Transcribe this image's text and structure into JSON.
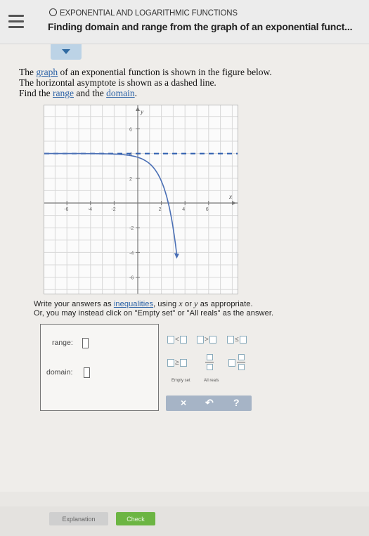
{
  "header": {
    "menu_icon": "hamburger-icon",
    "subtitle": "EXPONENTIAL AND LOGARITHMIC FUNCTIONS",
    "title": "Finding domain and range from the graph of an exponential funct..."
  },
  "problem": {
    "line1_pre": "The ",
    "line1_link": "graph",
    "line1_post": " of an exponential function is shown in the figure below.",
    "line2": "The horizontal asymptote is shown as a dashed line.",
    "line3_pre": "Find the ",
    "line3_link1": "range",
    "line3_mid": " and the ",
    "line3_link2": "domain",
    "line3_post": "."
  },
  "graph": {
    "y_axis_label": "y",
    "x_axis_label": "x",
    "x_ticks": [
      "-6",
      "-4",
      "-2",
      "2",
      "4",
      "6"
    ],
    "y_ticks": [
      "6",
      "4",
      "2",
      "-2",
      "-4",
      "-6"
    ],
    "asymptote_y": 4,
    "axis_range": [
      -7,
      7
    ]
  },
  "instructions": {
    "line1_pre": "Write your answers as ",
    "line1_link": "inequalities",
    "line1_mid": ", using ",
    "var_x": "x",
    "or": " or ",
    "var_y": "y",
    "line1_post": " as appropriate.",
    "line2": "Or, you may instead click on \"Empty set\" or \"All reals\" as the answer."
  },
  "answers": {
    "range_label": "range:",
    "domain_label": "domain:"
  },
  "palette": {
    "ops": [
      "<",
      ">",
      "≤",
      "≥"
    ],
    "empty_set": "Empty set",
    "all_reals": "All reals",
    "clear": "×",
    "undo": "↶",
    "help": "?"
  },
  "footer": {
    "explanation": "Explanation",
    "check": "Check"
  },
  "colors": {
    "curve": "#4a6fb5",
    "asymptote": "#2f5fb0",
    "link": "#2a61a6",
    "check": "#6cb543"
  }
}
